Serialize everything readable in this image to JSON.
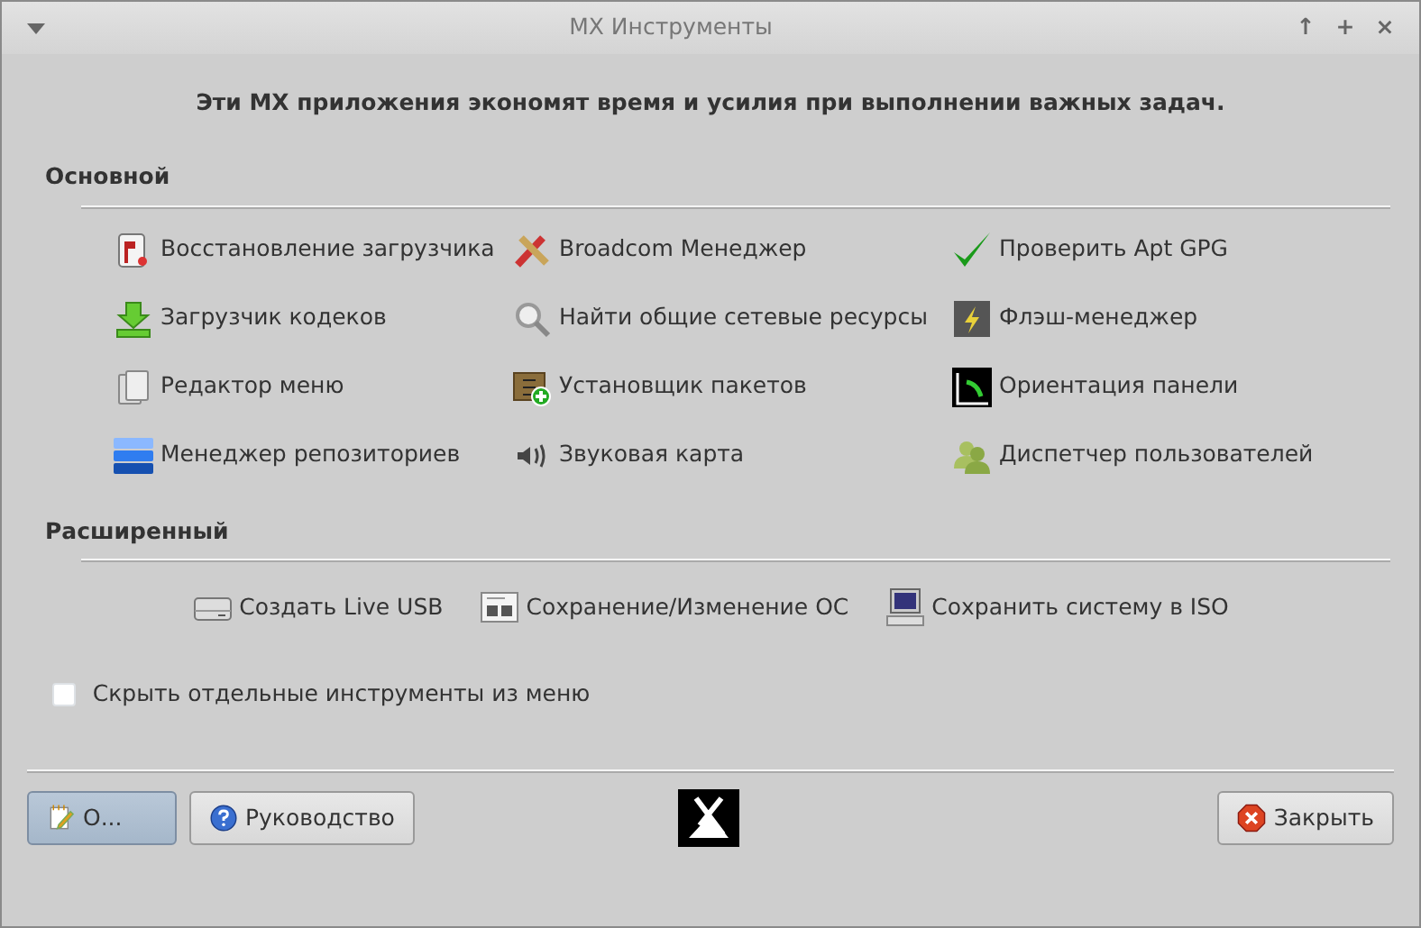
{
  "window": {
    "title": "MX Инструменты",
    "controls": [
      "↑",
      "+",
      "×"
    ]
  },
  "intro": "Эти MX приложения экономят время и усилия при выполнении важных задач.",
  "sections": [
    {
      "title": "Основной",
      "columns": [
        [
          {
            "label": "Восстановление загрузчика"
          },
          {
            "label": "Загрузчик кодеков"
          },
          {
            "label": "Редактор меню"
          },
          {
            "label": "Менеджер репозиториев"
          }
        ],
        [
          {
            "label": "Broadcom Менеджер"
          },
          {
            "label": "Найти общие сетевые ресурсы"
          },
          {
            "label": "Установщик пакетов"
          },
          {
            "label": "Звуковая карта"
          }
        ],
        [
          {
            "label": "Проверить Apt GPG"
          },
          {
            "label": "Флэш-менеджер"
          },
          {
            "label": "Ориентация панели"
          },
          {
            "label": "Диспетчер пользователей"
          }
        ]
      ]
    },
    {
      "title": "Расширенный",
      "columns": [
        [
          {
            "label": "Создать Live USB"
          }
        ],
        [
          {
            "label": "Сохранение/Изменение ОС"
          }
        ],
        [
          {
            "label": "Сохранить систему в ISO"
          }
        ]
      ]
    }
  ],
  "hide_option": {
    "label": "Скрыть отдельные инструменты из меню",
    "checked": false
  },
  "buttons": [
    {
      "label": "О...",
      "focused": true
    },
    {
      "label": "Руководство",
      "focused": false
    },
    {
      "label": "Закрыть",
      "focused": false
    }
  ]
}
